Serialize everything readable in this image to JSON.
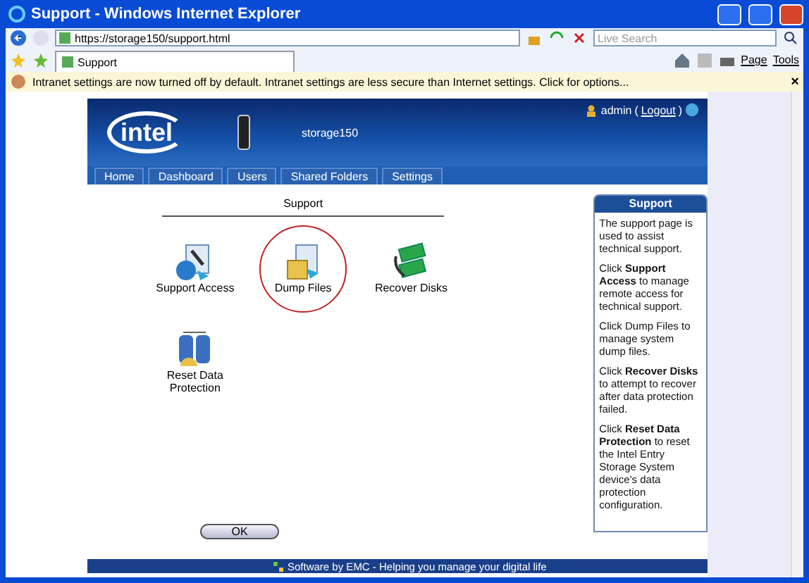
{
  "window": {
    "title": "Support - Windows Internet Explorer"
  },
  "address_bar": {
    "url": "https://storage150/support.html",
    "search_placeholder": "Live Search"
  },
  "browser_tab": {
    "label": "Support"
  },
  "command_bar": [
    "Page",
    "Tools"
  ],
  "info_bar": {
    "text": "Intranet settings are now turned off by default. Intranet settings are less secure than Internet settings. Click for options...",
    "close": "×"
  },
  "header": {
    "logo": "intel",
    "device": "storage150",
    "user": "admin",
    "logout_open": "(",
    "logout": "Logout",
    "logout_close": ")"
  },
  "nav": [
    "Home",
    "Dashboard",
    "Users",
    "Shared Folders",
    "Settings"
  ],
  "content": {
    "heading": "Support",
    "items": [
      {
        "kind": "access",
        "label": "Support Access",
        "highlighted": false
      },
      {
        "kind": "dump",
        "label": "Dump Files",
        "highlighted": true
      },
      {
        "kind": "recover",
        "label": "Recover Disks",
        "highlighted": false
      },
      {
        "kind": "reset",
        "label": "Reset Data Protection",
        "highlighted": false
      }
    ],
    "button": "OK"
  },
  "help": {
    "title": "Support",
    "paragraphs": [
      "The support page is used to assist technical support.",
      "Click **Support Access** to manage remote access for technical support.",
      "Click Dump Files to manage system dump files.",
      "Click **Recover Disks** to attempt to recover after data protection failed.",
      "Click **Reset Data Protection** to reset the Intel Entry Storage System device's data protection configuration."
    ]
  },
  "footer": "Software by EMC - Helping you manage your digital life"
}
